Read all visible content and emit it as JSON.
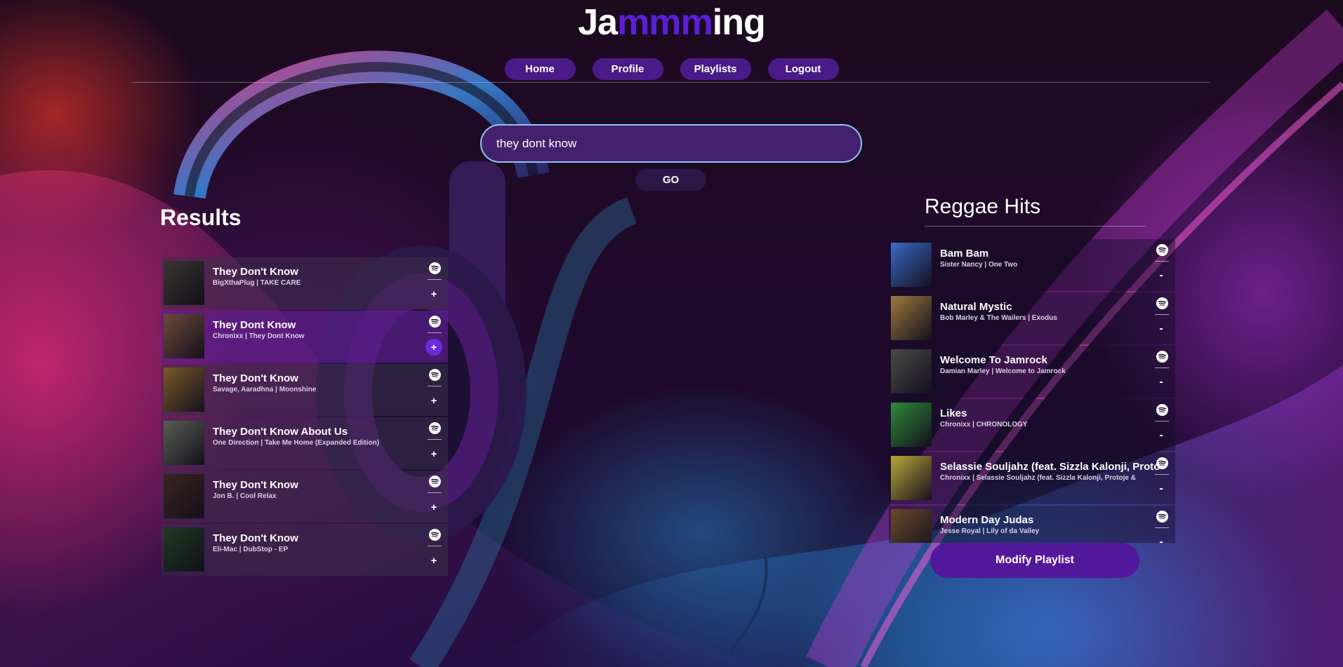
{
  "app": {
    "logo_part1": "Ja",
    "logo_part2": "mmm",
    "logo_part3": "ing",
    "accent_color": "#5a1fd6"
  },
  "nav": {
    "items": [
      {
        "label": "Home"
      },
      {
        "label": "Profile"
      },
      {
        "label": "Playlists"
      },
      {
        "label": "Logout"
      }
    ]
  },
  "search": {
    "value": "they dont know",
    "button_label": "GO"
  },
  "results": {
    "title": "Results",
    "tracks": [
      {
        "name": "They Don't Know",
        "meta": "BigXthaPlug | TAKE CARE",
        "action": "+",
        "selected": false,
        "art_color": "#3a3530"
      },
      {
        "name": "They Dont Know",
        "meta": "Chronixx | They Dont Know",
        "action": "+",
        "selected": true,
        "art_color": "#6e4a3a"
      },
      {
        "name": "They Don't Know",
        "meta": "Savage, Aaradhna | Moonshine",
        "action": "+",
        "selected": false,
        "art_color": "#7a5a2a"
      },
      {
        "name": "They Don't Know About Us",
        "meta": "One Direction | Take Me Home (Expanded Edition)",
        "action": "+",
        "selected": false,
        "art_color": "#5a5e52"
      },
      {
        "name": "They Don't Know",
        "meta": "Jon B. | Cool Relax",
        "action": "+",
        "selected": false,
        "art_color": "#3a2520"
      },
      {
        "name": "They Don't Know",
        "meta": "Eli-Mac | DubStop - EP",
        "action": "+",
        "selected": false,
        "art_color": "#1e3a22"
      }
    ]
  },
  "playlist": {
    "title": "Reggae Hits",
    "tracks": [
      {
        "name": "Bam Bam",
        "meta": "Sister Nancy | One Two",
        "action": "-",
        "art_color": "#3a6ac8"
      },
      {
        "name": "Natural Mystic",
        "meta": "Bob Marley & The Wailers | Exodus",
        "action": "-",
        "art_color": "#9a7a3e"
      },
      {
        "name": "Welcome To Jamrock",
        "meta": "Damian Marley | Welcome to Jamrock",
        "action": "-",
        "art_color": "#4a4a48"
      },
      {
        "name": "Likes",
        "meta": "Chronixx | CHRONOLOGY",
        "action": "-",
        "art_color": "#2e8a3a"
      },
      {
        "name": "Selassie Souljahz (feat. Sizzla Kalonji, Proto",
        "meta": "Chronixx | Selassie Souljahz (feat. Sizzla Kalonji, Protoje &",
        "action": "-",
        "art_color": "#b8a83a"
      },
      {
        "name": "Modern Day Judas",
        "meta": "Jesse Royal | Lily of da Valley",
        "action": "-",
        "art_color": "#6a4a2a"
      }
    ],
    "modify_label": "Modify Playlist"
  }
}
